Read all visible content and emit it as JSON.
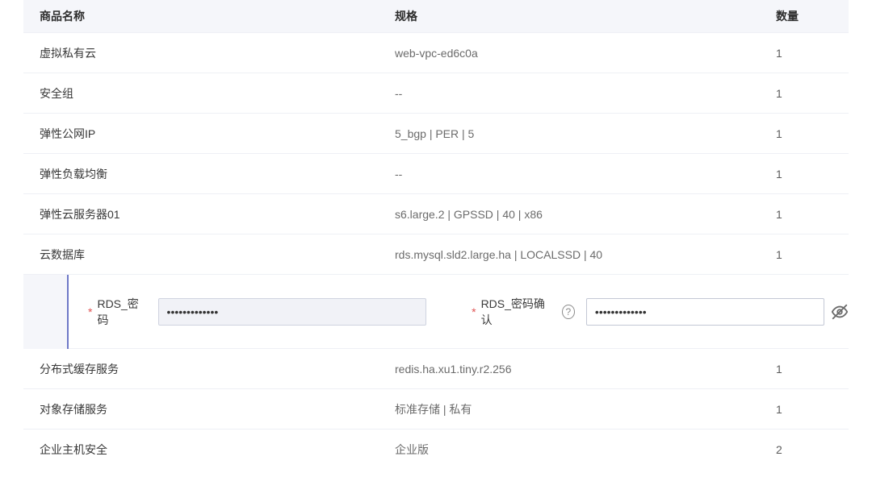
{
  "headers": {
    "name": "商品名称",
    "spec": "规格",
    "qty": "数量"
  },
  "rows": [
    {
      "name": "虚拟私有云",
      "spec": "web-vpc-ed6c0a",
      "qty": "1"
    },
    {
      "name": "安全组",
      "spec": "--",
      "qty": "1"
    },
    {
      "name": "弹性公网IP",
      "spec": "5_bgp | PER | 5",
      "qty": "1"
    },
    {
      "name": "弹性负载均衡",
      "spec": "--",
      "qty": "1"
    },
    {
      "name": "弹性云服务器01",
      "spec": "s6.large.2 | GPSSD | 40 | x86",
      "qty": "1"
    },
    {
      "name": "云数据库",
      "spec": "rds.mysql.sld2.large.ha | LOCALSSD | 40",
      "qty": "1"
    },
    {
      "name": "分布式缓存服务",
      "spec": "redis.ha.xu1.tiny.r2.256",
      "qty": "1"
    },
    {
      "name": "对象存储服务",
      "spec": "标准存储 | 私有",
      "qty": "1"
    },
    {
      "name": "企业主机安全",
      "spec": "企业版",
      "qty": "2"
    }
  ],
  "expand": {
    "pw_label": "RDS_密码",
    "pw_confirm_label": "RDS_密码确认",
    "pw_value": "•••••••••••••",
    "pw_confirm_value": "•••••••••••••",
    "required_mark": "*",
    "help_glyph": "?"
  }
}
